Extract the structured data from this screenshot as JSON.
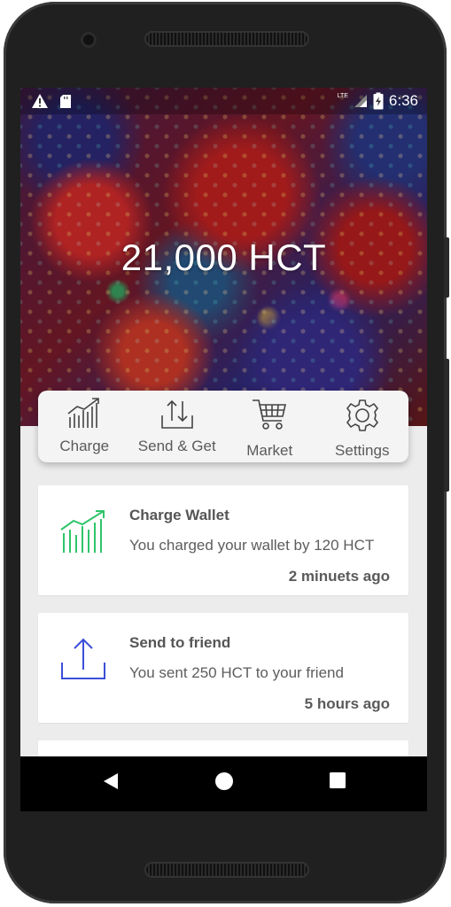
{
  "status_bar": {
    "time": "6:36",
    "network_label": "LTE",
    "icons": [
      "warning-icon",
      "sd-card-icon",
      "signal-icon",
      "battery-charging-icon"
    ]
  },
  "wallet": {
    "balance": "21,000 HCT"
  },
  "actions": [
    {
      "label": "Charge",
      "icon": "chart-growth-icon"
    },
    {
      "label": "Send & Get",
      "icon": "upload-download-icon"
    },
    {
      "label": "Market",
      "icon": "shopping-cart-icon"
    },
    {
      "label": "Settings",
      "icon": "gear-icon"
    }
  ],
  "transactions": [
    {
      "title": "Charge Wallet",
      "description": "You charged your wallet by 120 HCT",
      "time": "2 minuets ago",
      "icon": "chart-growth-icon",
      "color": "#2fc46a"
    },
    {
      "title": "Send to friend",
      "description": "You sent 250 HCT to your friend",
      "time": "5 hours ago",
      "icon": "upload-icon",
      "color": "#3b4fd8"
    }
  ],
  "nav_bar": {
    "buttons": [
      "back-icon",
      "home-icon",
      "recents-icon"
    ]
  }
}
